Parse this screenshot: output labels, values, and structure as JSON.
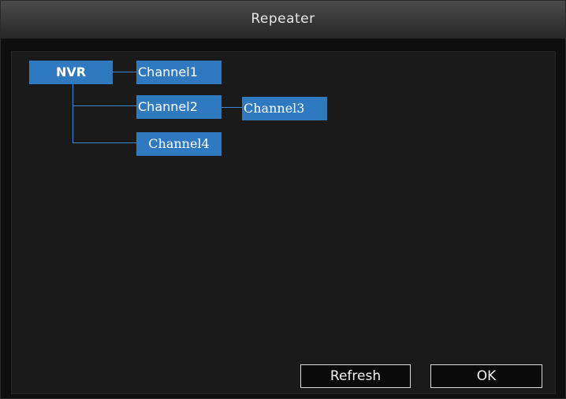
{
  "window": {
    "title": "Repeater"
  },
  "tree": {
    "root": "NVR",
    "channels": [
      "Channel1",
      "Channel2",
      "Channel3",
      "Channel4"
    ]
  },
  "buttons": {
    "refresh": "Refresh",
    "ok": "OK"
  },
  "colors": {
    "node_fill": "#2f79c0",
    "line": "#3b88d4",
    "background": "#1a1a1a"
  }
}
